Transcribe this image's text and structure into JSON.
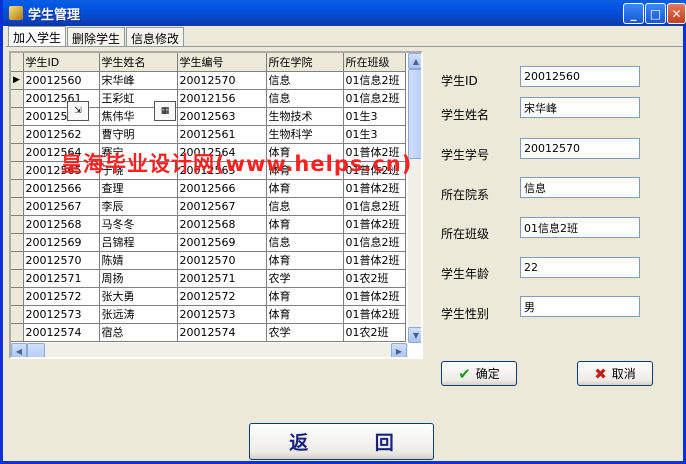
{
  "window": {
    "title": "学生管理"
  },
  "tabs": [
    {
      "label": "加入学生"
    },
    {
      "label": "删除学生"
    },
    {
      "label": "信息修改"
    }
  ],
  "grid": {
    "columns": [
      "学生ID",
      "学生姓名",
      "学生编号",
      "所在学院",
      "所在班级"
    ],
    "rows": [
      [
        "20012560",
        "宋华峰",
        "20012570",
        "信息",
        "01信息2班"
      ],
      [
        "20012561",
        "王彩虹",
        "20012156",
        "信息",
        "01信息2班"
      ],
      [
        "20012563",
        "焦伟华",
        "20012563",
        "生物技术",
        "01生3"
      ],
      [
        "20012562",
        "曹守明",
        "20012561",
        "生物科学",
        "01生3"
      ],
      [
        "20012564",
        "赛宁",
        "20012564",
        "体育",
        "01普体2班"
      ],
      [
        "20012565",
        "于晓",
        "20012565",
        "体育",
        "01普体2班"
      ],
      [
        "20012566",
        "查理",
        "20012566",
        "体育",
        "01普体2班"
      ],
      [
        "20012567",
        "李辰",
        "20012567",
        "信息",
        "01信息2班"
      ],
      [
        "20012568",
        "马冬冬",
        "20012568",
        "体育",
        "01普体2班"
      ],
      [
        "20012569",
        "吕锦程",
        "20012569",
        "信息",
        "01信息2班"
      ],
      [
        "20012570",
        "陈婧",
        "20012570",
        "体育",
        "01普体2班"
      ],
      [
        "20012571",
        "周扬",
        "20012571",
        "农学",
        "01农2班"
      ],
      [
        "20012572",
        "张大勇",
        "20012572",
        "体育",
        "01普体2班"
      ],
      [
        "20012573",
        "张远涛",
        "20012573",
        "体育",
        "01普体2班"
      ],
      [
        "20012574",
        "宿总",
        "20012574",
        "农学",
        "01农2班"
      ]
    ]
  },
  "form": {
    "student_id": {
      "label": "学生ID",
      "value": "20012560"
    },
    "student_name": {
      "label": "学生姓名",
      "value": "宋华峰"
    },
    "student_number": {
      "label": "学生学号",
      "value": "20012570"
    },
    "department": {
      "label": "所在院系",
      "value": "信息"
    },
    "class": {
      "label": "所在班级",
      "value": "01信息2班"
    },
    "age": {
      "label": "学生年龄",
      "value": "22"
    },
    "gender": {
      "label": "学生性别",
      "value": "男"
    }
  },
  "buttons": {
    "confirm": "确定",
    "cancel": "取消",
    "return": "返 回"
  },
  "watermark": "皇海毕业设计网(www.helps.cn)",
  "colors": {
    "titlebar": "#0054e3",
    "watermark": "#ff2020",
    "confirm_icon": "#1a9a1a",
    "cancel_icon": "#c0201a"
  }
}
